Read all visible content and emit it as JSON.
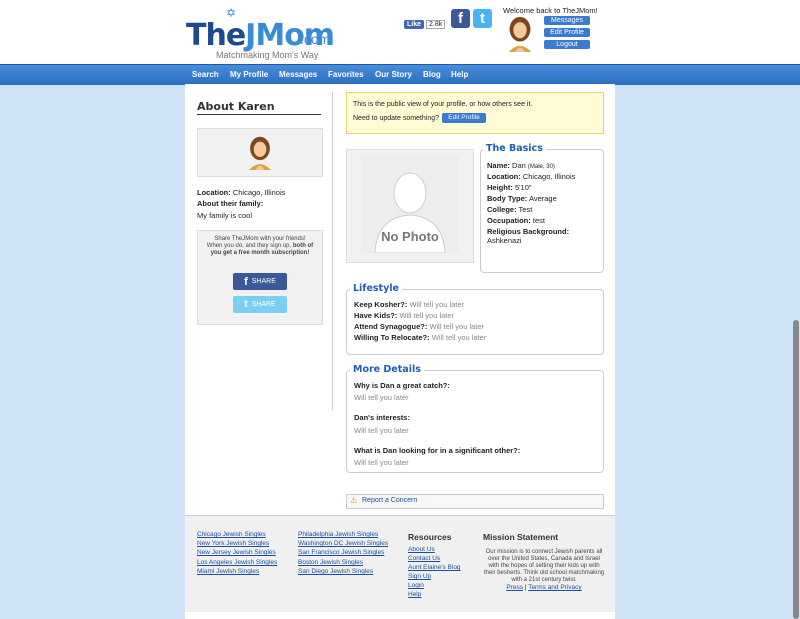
{
  "header": {
    "logo_main": "The",
    "logo_j": "JMom",
    "logo_com": ".com",
    "logo_tagline": "Matchmaking Mom's Way",
    "fb_like_label": "Like",
    "fb_like_count": "2.8k",
    "welcome_text": "Welcome back to TheJMom!",
    "buttons": [
      "Messages",
      "Edit Profile",
      "Logout"
    ]
  },
  "nav": {
    "items": [
      "Search",
      "My Profile",
      "Messages",
      "Favorites",
      "Our Story",
      "Blog",
      "Help"
    ]
  },
  "sidebar": {
    "title": "About Karen",
    "location_label": "Location:",
    "location_value": "Chicago, Illinois",
    "family_label": "About their family:",
    "family_value": "My family is cool",
    "share_text_1": "Share TheJMom with your friends!",
    "share_text_2": "When you do, and they sign up,",
    "share_text_bold": "both of you get a free month subscription!",
    "share_fb_label": "SHARE",
    "share_tw_label": "SHARE"
  },
  "notice": {
    "line1": "This is the public view of your profile, or how others see it.",
    "line2": "Need to update something?",
    "button": "Edit Profile"
  },
  "photo": {
    "placeholder": "No Photo"
  },
  "basics": {
    "title": "The Basics",
    "rows": [
      {
        "label": "Name:",
        "value": "Dan",
        "extra": "(Male, 30)"
      },
      {
        "label": "Location:",
        "value": "Chicago, Illinois"
      },
      {
        "label": "Height:",
        "value": "5'10\""
      },
      {
        "label": "Body Type:",
        "value": "Average"
      },
      {
        "label": "College:",
        "value": "Test"
      },
      {
        "label": "Occupation:",
        "value": "test"
      },
      {
        "label": "Religious Background:",
        "value": "Ashkenazi"
      }
    ]
  },
  "lifestyle": {
    "title": "Lifestyle",
    "rows": [
      {
        "label": "Keep Kosher?:",
        "value": "Will tell you later"
      },
      {
        "label": "Have Kids?:",
        "value": "Will tell you later"
      },
      {
        "label": "Attend Synagogue?:",
        "value": "Will tell you later"
      },
      {
        "label": "Willing To Relocate?:",
        "value": "Will tell you later"
      }
    ]
  },
  "details": {
    "title": "More Details",
    "rows": [
      {
        "label": "Why is Dan a great catch?:",
        "value": "Will tell you later"
      },
      {
        "label": "Dan's interests:",
        "value": "Will tell you later"
      },
      {
        "label": "What is Dan looking for in a significant other?:",
        "value": "Will tell you later"
      }
    ]
  },
  "concern": {
    "label": "Report a Concern"
  },
  "footer": {
    "col1": [
      "Chicago Jewish Singles",
      "New York Jewish Singles",
      "New Jersey Jewish Singles",
      "Los Angeles Jewish Singles",
      "Miami Jewish Singles"
    ],
    "col2": [
      "Philadelphia Jewish Singles",
      "Washington DC Jewish Singles",
      "San Francisco Jewish Singles",
      "Boston Jewish Singles",
      "San Diego Jewish Singles"
    ],
    "resources_title": "Resources",
    "resources": [
      "About Us",
      "Contact Us",
      "Aunt Elaine's Blog",
      "Sign Up",
      "Login",
      "Help"
    ],
    "mission_title": "Mission Statement",
    "mission_text": "Our mission is to connect Jewish parents all over the United States, Canada and Israel with the hopes of setting their kids up with their besherts. Think old school matchmaking with a 21st century twist.",
    "press": "Press",
    "sep": "|",
    "terms": "Terms and Privacy"
  }
}
